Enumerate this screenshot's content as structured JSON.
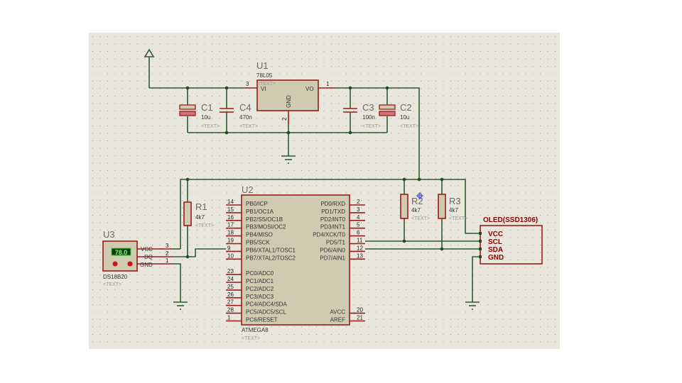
{
  "colors": {
    "canvas": "#e9e6dc",
    "wire": "#2f5a2f",
    "pin": "#9b1c1c",
    "body": "#cfcab0"
  },
  "text_placeholder": "<TEXT>",
  "u1": {
    "ref": "U1",
    "part": "78L05",
    "pin_vi": "VI",
    "pin_vo": "VO",
    "pin_gnd": "GND",
    "n_vi": "3",
    "n_vo": "1",
    "n_gnd": "2"
  },
  "c1": {
    "ref": "C1",
    "value": "10u"
  },
  "c4": {
    "ref": "C4",
    "value": "470n"
  },
  "c3": {
    "ref": "C3",
    "value": "100n"
  },
  "c2": {
    "ref": "C2",
    "value": "10u"
  },
  "r1": {
    "ref": "R1",
    "value": "4k7"
  },
  "r2": {
    "ref": "R2",
    "value": "4k7"
  },
  "r3": {
    "ref": "R3",
    "value": "4k7"
  },
  "u3": {
    "ref": "U3",
    "part": "DS18B20",
    "display": "78.0",
    "pins": [
      "VCC",
      "DQ",
      "GND"
    ],
    "nums": [
      "3",
      "2",
      "1"
    ]
  },
  "u2": {
    "ref": "U2",
    "part": "ATMEGA8",
    "left": [
      [
        "14",
        "PB0/ICP"
      ],
      [
        "15",
        "PB1/OC1A"
      ],
      [
        "16",
        "PB2/SS/OC1B"
      ],
      [
        "17",
        "PB3/MOSI/OC2"
      ],
      [
        "18",
        "PB4/MISO"
      ],
      [
        "19",
        "PB5/SCK"
      ],
      [
        "9",
        "PB6/XTAL1/TOSC1"
      ],
      [
        "10",
        "PB7/XTAL2/TOSC2"
      ],
      [
        "",
        ""
      ],
      [
        "23",
        "PC0/ADC0"
      ],
      [
        "24",
        "PC1/ADC1"
      ],
      [
        "25",
        "PC2/ADC2"
      ],
      [
        "26",
        "PC3/ADC3"
      ],
      [
        "27",
        "PC4/ADC4/SDA"
      ],
      [
        "28",
        "PC5/ADC5/SCL"
      ],
      [
        "1",
        "PC6/RESET"
      ]
    ],
    "right": [
      [
        "2",
        "PD0/RXD"
      ],
      [
        "3",
        "PD1/TXD"
      ],
      [
        "4",
        "PD2/INT0"
      ],
      [
        "5",
        "PD3/INT1"
      ],
      [
        "6",
        "PD4/XCK/T0"
      ],
      [
        "11",
        "PD5/T1"
      ],
      [
        "12",
        "PD6/AIN0"
      ],
      [
        "13",
        "PD7/AIN1"
      ],
      [
        "",
        ""
      ],
      [
        "",
        ""
      ],
      [
        "",
        ""
      ],
      [
        "",
        ""
      ],
      [
        "",
        ""
      ],
      [
        "",
        ""
      ],
      [
        "20",
        "AVCC"
      ],
      [
        "21",
        "AREF"
      ]
    ]
  },
  "oled": {
    "title": "OLED(SSD1306)",
    "pins": [
      "VCC",
      "SCL",
      "SDA",
      "GND"
    ]
  }
}
